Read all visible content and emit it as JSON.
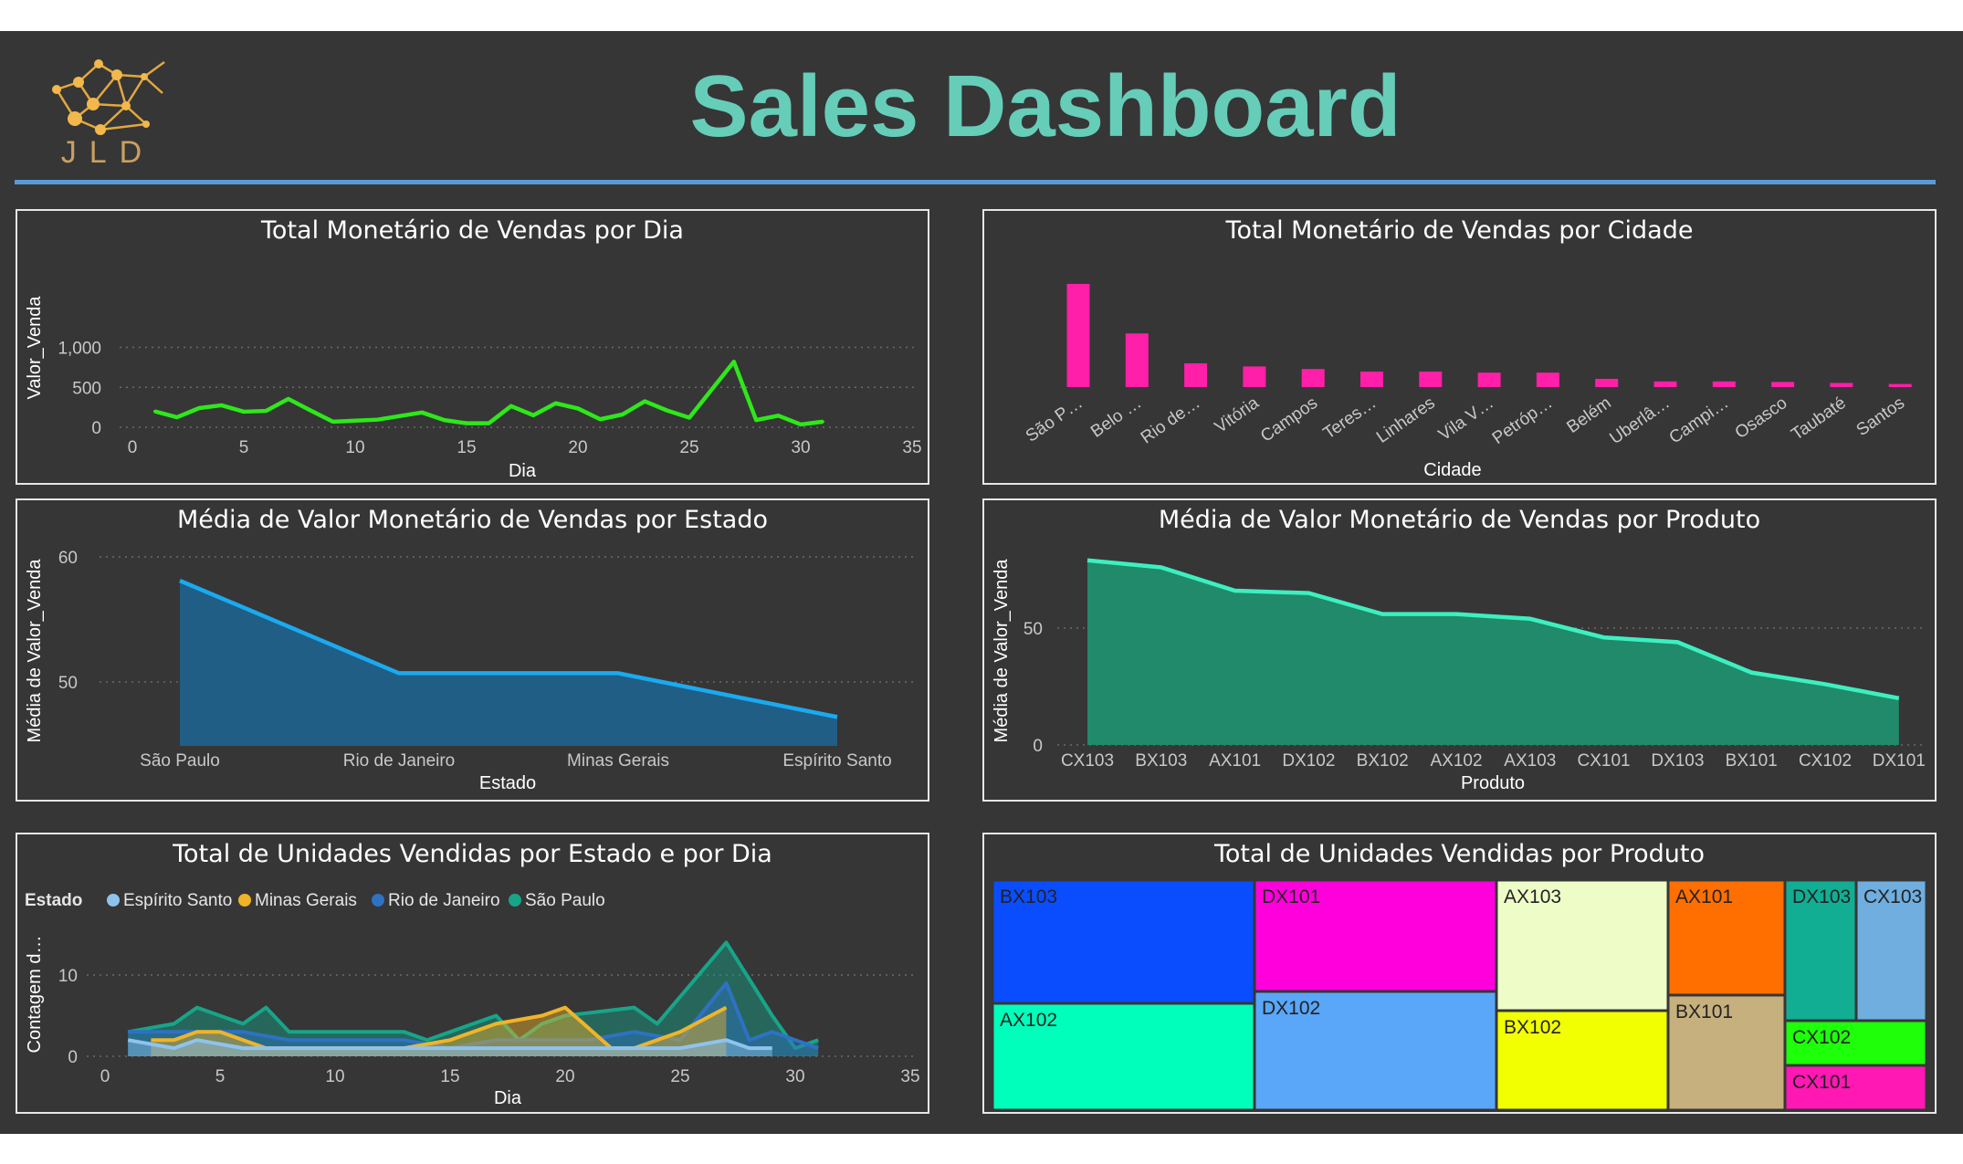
{
  "dashboard": {
    "title": "Sales Dashboard",
    "logo_text": "JLD",
    "accent_color": "#66CDB8"
  },
  "charts": {
    "vendas_dia": {
      "title": "Total Monetário de Vendas por Dia",
      "xlabel": "Dia",
      "ylabel": "Valor_Venda",
      "xticks": [
        "0",
        "5",
        "10",
        "15",
        "20",
        "25",
        "30",
        "35"
      ],
      "yticks": [
        "0",
        "500",
        "1,000"
      ],
      "color": "#2EE81A"
    },
    "vendas_cidade": {
      "title": "Total Monetário de Vendas por Cidade",
      "xlabel": "Cidade",
      "categories": [
        "São P…",
        "Belo …",
        "Rio de…",
        "Vitória",
        "Campos",
        "Teres…",
        "Linhares",
        "Vila V…",
        "Petróp…",
        "Belém",
        "Uberlâ…",
        "Campi…",
        "Osasco",
        "Taubaté",
        "Santos"
      ],
      "color": "#FF1FA8"
    },
    "media_estado": {
      "title": "Média de Valor Monetário de Vendas por Estado",
      "xlabel": "Estado",
      "ylabel": "Média de Valor_Venda",
      "categories": [
        "São Paulo",
        "Rio de Janeiro",
        "Minas Gerais",
        "Espírito Santo"
      ],
      "yticks": [
        "50",
        "60"
      ],
      "color": "#1AAAF0"
    },
    "media_produto": {
      "title": "Média de Valor Monetário de Vendas por Produto",
      "xlabel": "Produto",
      "ylabel": "Média de Valor_Venda",
      "categories": [
        "CX103",
        "BX103",
        "AX101",
        "DX102",
        "BX102",
        "AX102",
        "AX103",
        "CX101",
        "DX103",
        "BX101",
        "CX102",
        "DX101"
      ],
      "yticks": [
        "0",
        "50"
      ],
      "color": "#3CF0C0"
    },
    "unidades_estado_dia": {
      "title": "Total de Unidades Vendidas por Estado e por Dia",
      "xlabel": "Dia",
      "ylabel": "Contagem d…",
      "legend_title": "Estado",
      "legend": [
        {
          "name": "Espírito Santo",
          "color": "#8EC3EE"
        },
        {
          "name": "Minas Gerais",
          "color": "#F0B429"
        },
        {
          "name": "Rio de Janeiro",
          "color": "#2D72C4"
        },
        {
          "name": "São Paulo",
          "color": "#17A589"
        }
      ],
      "xticks": [
        "0",
        "5",
        "10",
        "15",
        "20",
        "25",
        "30",
        "35"
      ],
      "yticks": [
        "0",
        "10"
      ]
    },
    "unidades_produto": {
      "title": "Total de Unidades Vendidas por Produto",
      "products": [
        {
          "name": "BX103",
          "color": "#0A4DFF"
        },
        {
          "name": "AX102",
          "color": "#00FFBB"
        },
        {
          "name": "DX101",
          "color": "#FF00DD"
        },
        {
          "name": "DX102",
          "color": "#5AA6F8"
        },
        {
          "name": "AX103",
          "color": "#EEFCC8"
        },
        {
          "name": "BX102",
          "color": "#F2FF00"
        },
        {
          "name": "AX101",
          "color": "#FF6F00"
        },
        {
          "name": "BX101",
          "color": "#C6B07E"
        },
        {
          "name": "DX103",
          "color": "#11AE93"
        },
        {
          "name": "CX103",
          "color": "#6FAEDF"
        },
        {
          "name": "CX102",
          "color": "#1EFF0A"
        },
        {
          "name": "CX101",
          "color": "#FF18B4"
        }
      ]
    }
  },
  "chart_data": [
    {
      "type": "line",
      "title": "Total Monetário de Vendas por Dia",
      "xlabel": "Dia",
      "ylabel": "Valor_Venda",
      "xlim": [
        0,
        35
      ],
      "ylim": [
        0,
        1000
      ],
      "x": [
        1,
        2,
        3,
        4,
        5,
        6,
        7,
        8,
        9,
        11,
        13,
        14,
        15,
        16,
        17,
        18,
        19,
        20,
        21,
        22,
        23,
        24,
        25,
        26,
        27,
        28,
        29,
        30,
        31
      ],
      "y": [
        200,
        125,
        240,
        275,
        195,
        205,
        355,
        210,
        70,
        95,
        185,
        90,
        50,
        50,
        265,
        150,
        300,
        235,
        100,
        160,
        325,
        210,
        120,
        470,
        820,
        90,
        145,
        35,
        70
      ]
    },
    {
      "type": "bar",
      "title": "Total Monetário de Vendas por Cidade",
      "xlabel": "Cidade",
      "categories": [
        "São P…",
        "Belo …",
        "Rio de…",
        "Vitória",
        "Campos",
        "Teres…",
        "Linhares",
        "Vila V…",
        "Petróp…",
        "Belém",
        "Uberlâ…",
        "Campi…",
        "Osasco",
        "Taubaté",
        "Santos"
      ],
      "values": [
        1000,
        520,
        230,
        200,
        175,
        150,
        150,
        140,
        140,
        80,
        55,
        55,
        50,
        40,
        30
      ]
    },
    {
      "type": "area",
      "title": "Média de Valor Monetário de Vendas por Estado",
      "xlabel": "Estado",
      "ylabel": "Média de Valor_Venda",
      "categories": [
        "São Paulo",
        "Rio de Janeiro",
        "Minas Gerais",
        "Espírito Santo"
      ],
      "values": [
        58.1,
        50.7,
        50.7,
        47.2
      ],
      "ylim": [
        45,
        62
      ]
    },
    {
      "type": "area",
      "title": "Média de Valor Monetário de Vendas por Produto",
      "xlabel": "Produto",
      "ylabel": "Média de Valor_Venda",
      "categories": [
        "CX103",
        "BX103",
        "AX101",
        "DX102",
        "BX102",
        "AX102",
        "AX103",
        "CX101",
        "DX103",
        "BX101",
        "CX102",
        "DX101"
      ],
      "values": [
        79,
        76,
        66,
        65,
        56,
        56,
        54,
        46,
        44,
        31,
        26,
        20
      ],
      "ylim": [
        0,
        85
      ]
    },
    {
      "type": "area",
      "title": "Total de Unidades Vendidas por Estado e por Dia",
      "xlabel": "Dia",
      "ylabel": "Contagem d…",
      "xlim": [
        0,
        35
      ],
      "ylim": [
        0,
        15
      ],
      "series": [
        {
          "name": "São Paulo",
          "x": [
            1,
            3,
            4,
            6,
            7,
            8,
            13,
            14,
            17,
            18,
            19,
            20,
            23,
            24,
            27,
            29,
            30,
            31
          ],
          "values": [
            3,
            4,
            6,
            4,
            6,
            3,
            3,
            2,
            5,
            2,
            4,
            5,
            6,
            4,
            14,
            5,
            1,
            2
          ]
        },
        {
          "name": "Rio de Janeiro",
          "x": [
            1,
            2,
            4,
            6,
            8,
            11,
            13,
            15,
            17,
            19,
            21,
            23,
            25,
            27,
            28,
            29,
            30,
            31
          ],
          "values": [
            3,
            3,
            3,
            3,
            2,
            2,
            2,
            1,
            2,
            2,
            2,
            3,
            2,
            9,
            2,
            3,
            2,
            1
          ]
        },
        {
          "name": "Minas Gerais",
          "x": [
            2,
            3,
            4,
            5,
            7,
            10,
            13,
            15,
            17,
            19,
            20,
            22,
            23,
            25,
            27
          ],
          "values": [
            2,
            2,
            3,
            3,
            1,
            1,
            1,
            2,
            4,
            5,
            6,
            1,
            1,
            3,
            6
          ]
        },
        {
          "name": "Espírito Santo",
          "x": [
            1,
            3,
            4,
            6,
            9,
            11,
            14,
            17,
            20,
            23,
            25,
            27,
            28,
            29
          ],
          "values": [
            2,
            1,
            2,
            1,
            1,
            1,
            1,
            1,
            1,
            1,
            1,
            2,
            1,
            1
          ]
        }
      ]
    },
    {
      "type": "treemap",
      "title": "Total de Unidades Vendidas por Produto",
      "categories": [
        "BX103",
        "AX102",
        "DX101",
        "DX102",
        "AX103",
        "BX102",
        "AX101",
        "BX101",
        "DX103",
        "CX103",
        "CX102",
        "CX101"
      ],
      "values": [
        36,
        31,
        30,
        32,
        25,
        19,
        15,
        15,
        11,
        11,
        7,
        7
      ]
    }
  ]
}
